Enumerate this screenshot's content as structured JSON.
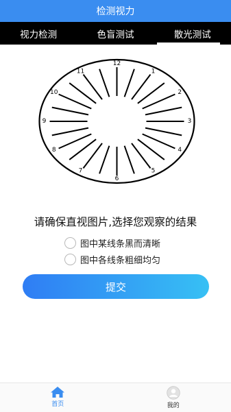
{
  "header": {
    "title": "检测视力"
  },
  "tabs": [
    {
      "label": "视力检测",
      "active": false
    },
    {
      "label": "色盲测试",
      "active": false
    },
    {
      "label": "散光测试",
      "active": true
    }
  ],
  "dial": {
    "labels": [
      "12",
      "1",
      "2",
      "3",
      "4",
      "5",
      "6",
      "7",
      "8",
      "9",
      "10",
      "11"
    ],
    "line_count": 24
  },
  "question": "请确保直视图片,选择您观察的结果",
  "options": [
    {
      "label": "图中某线条黑而清晰",
      "selected": false
    },
    {
      "label": "图中各线条粗细均匀",
      "selected": false
    }
  ],
  "submit_label": "提交",
  "bottom_nav": [
    {
      "label": "首页",
      "icon": "home-icon",
      "active": true
    },
    {
      "label": "我的",
      "icon": "user-icon",
      "active": false
    }
  ],
  "colors": {
    "accent": "#3a8df0",
    "tab_bar": "#000000",
    "button_gradient_start": "#2f7df4",
    "button_gradient_end": "#37c0f4"
  }
}
